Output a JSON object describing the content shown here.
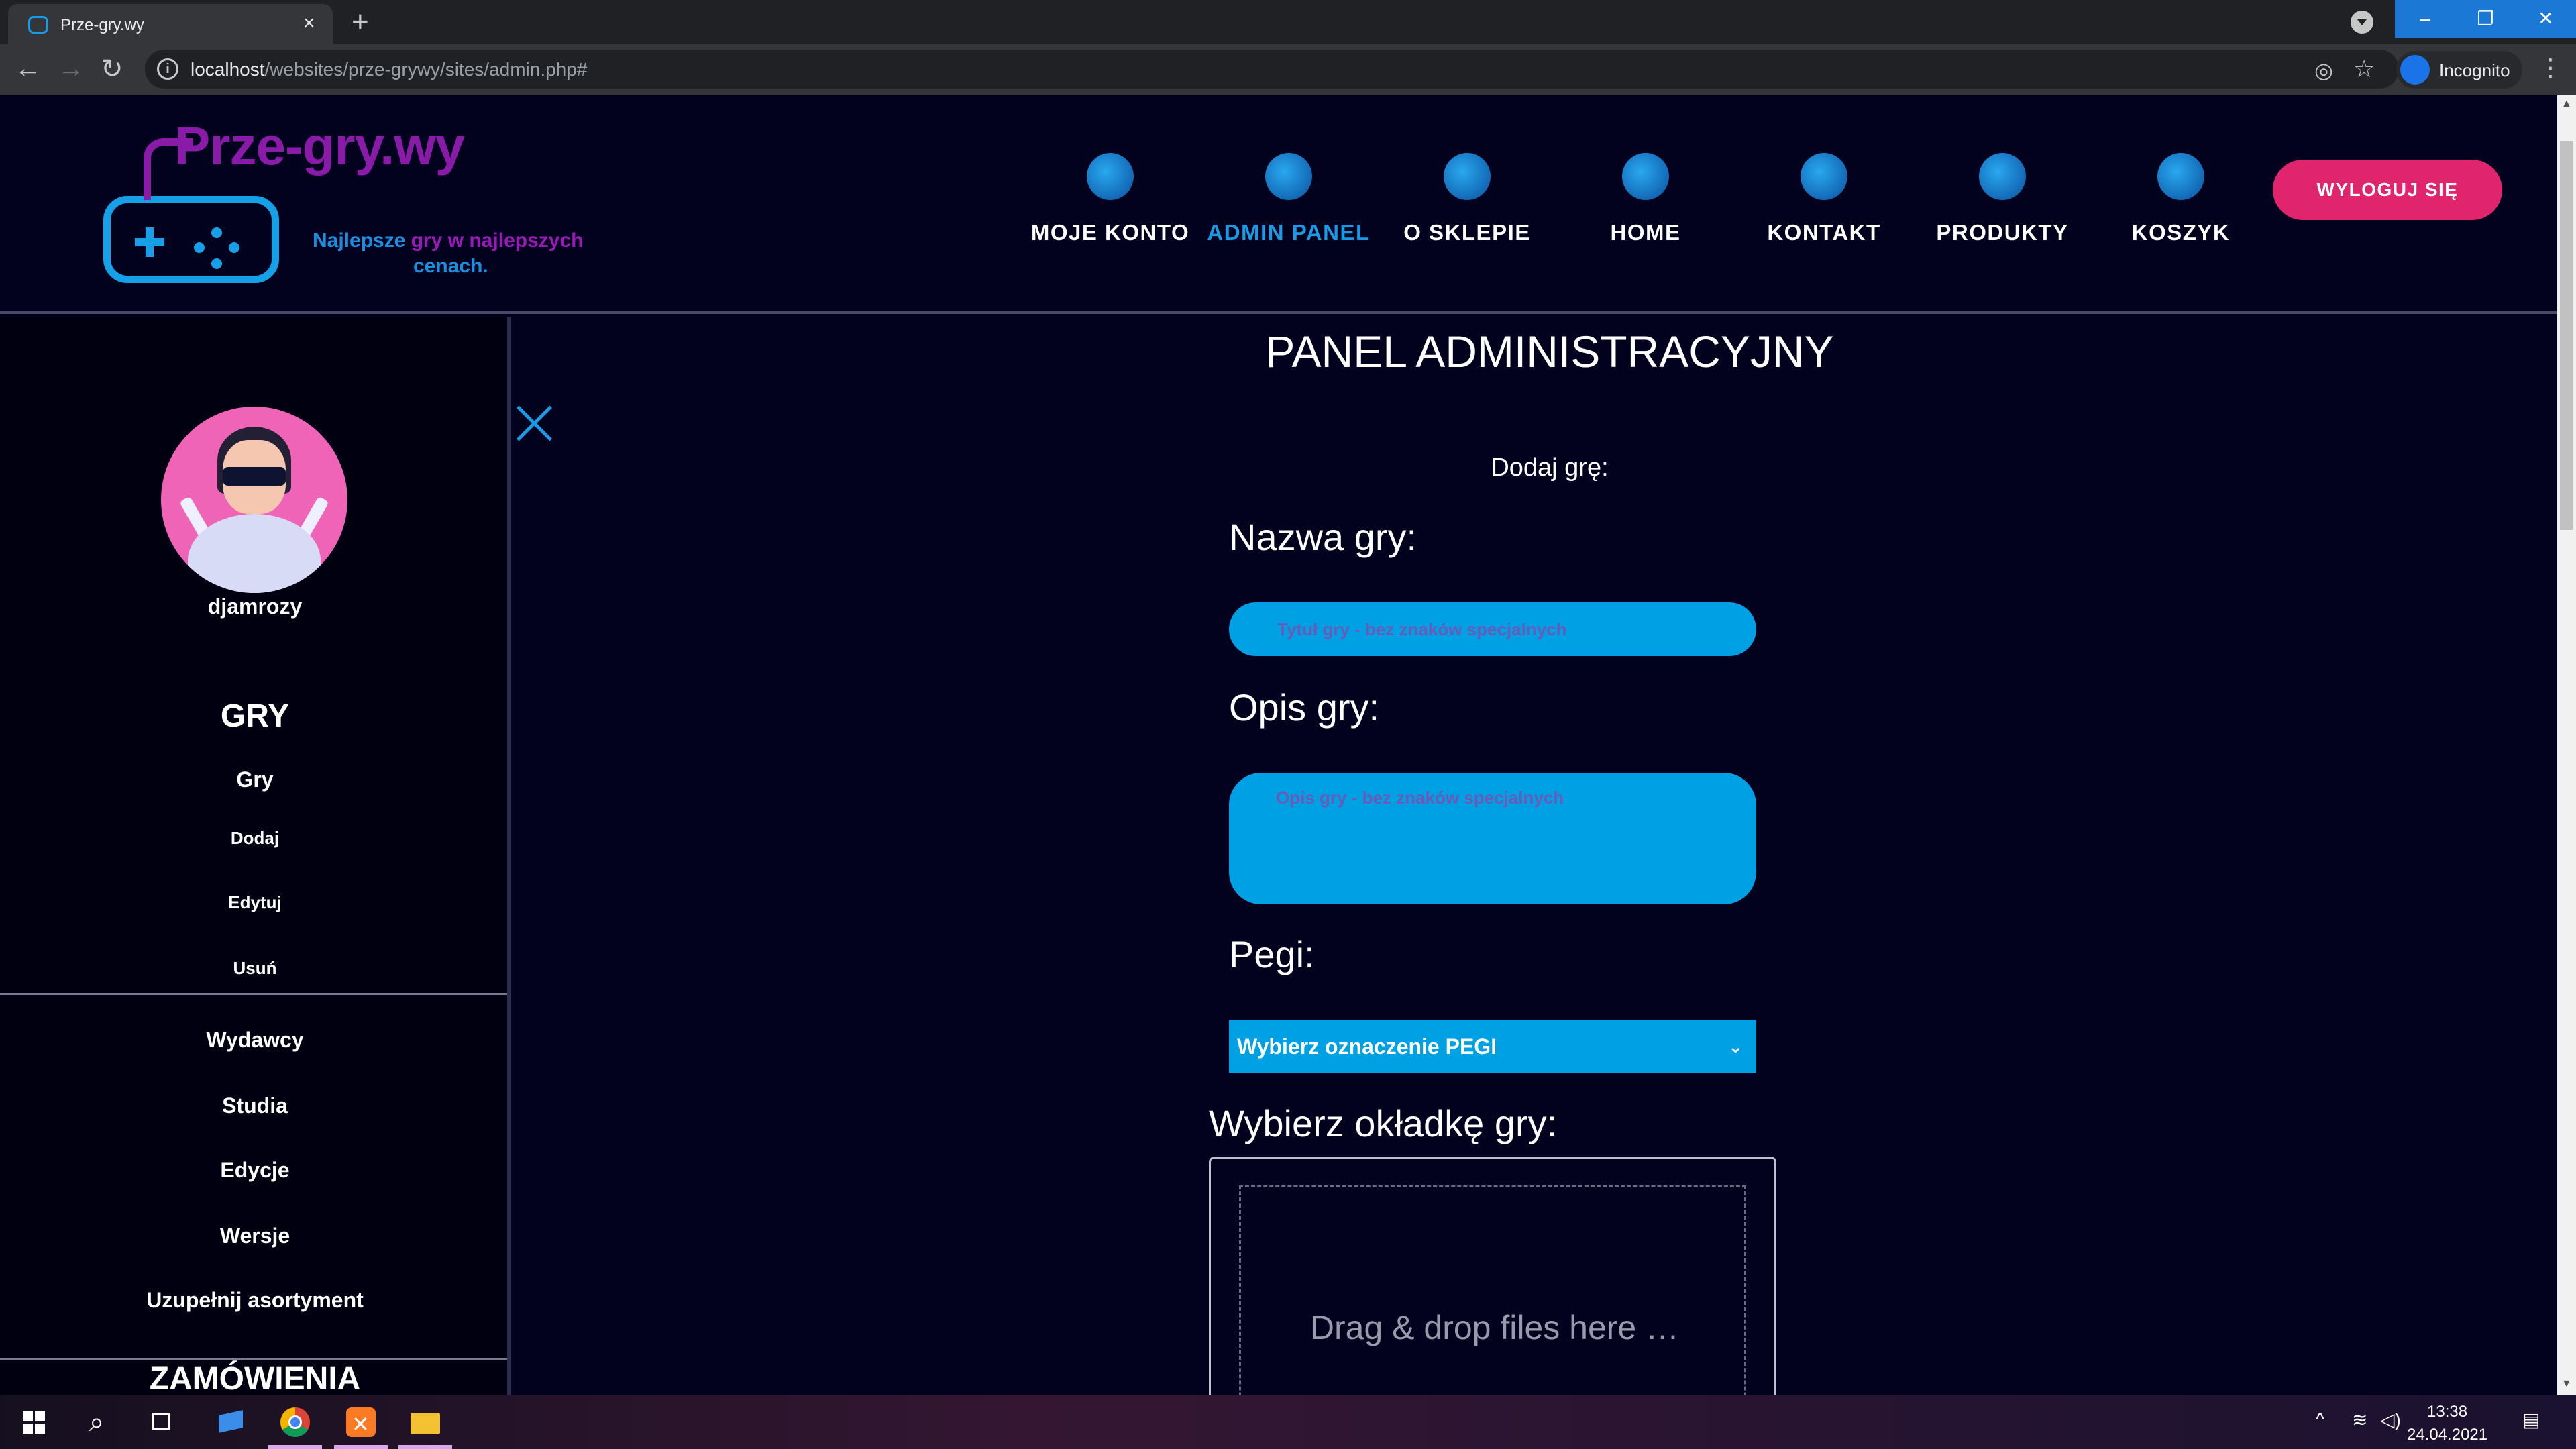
{
  "browser": {
    "tab_title": "Prze-gry.wy",
    "tab_close": "×",
    "new_tab": "+",
    "url_host": "localhost",
    "url_path": "/websites/prze-grywy/sites/admin.php#",
    "profile_label": "Incognito",
    "back": "←",
    "forward": "→",
    "reload": "↻",
    "star": "☆",
    "kebab": "⋮",
    "minimize": "–",
    "restore": "❐",
    "close": "✕"
  },
  "header": {
    "logo_title": "Prze-gry.wy",
    "logo_tagline_1": "Najlepsze ",
    "logo_tagline_2": "gry",
    "logo_tagline_3": " w najlepszych",
    "logo_tagline_4": "cenach.",
    "nav": [
      {
        "label": "MOJE KONTO",
        "icon": "account-icon"
      },
      {
        "label": "ADMIN PANEL",
        "icon": "admin-icon",
        "active": true
      },
      {
        "label": "O SKLEPIE",
        "icon": "about-icon"
      },
      {
        "label": "HOME",
        "icon": "home-icon"
      },
      {
        "label": "KONTAKT",
        "icon": "phone-icon"
      },
      {
        "label": "PRODUKTY",
        "icon": "gamepad-icon"
      },
      {
        "label": "KOSZYK",
        "icon": "cart-icon"
      }
    ],
    "logout_label": "WYLOGUJ SIĘ"
  },
  "sidebar": {
    "username": "djamrozy",
    "section_games": "GRY",
    "games_items": [
      "Gry",
      "Dodaj",
      "Edytuj",
      "Usuń"
    ],
    "other_items": [
      "Wydawcy",
      "Studia",
      "Edycje",
      "Wersje",
      "Uzupełnij asortyment"
    ],
    "section_orders": "ZAMÓWIENIA"
  },
  "main": {
    "title": "PANEL ADMINISTRACYJNY",
    "form_heading": "Dodaj grę:",
    "name_label": "Nazwa gry:",
    "name_placeholder": "Tytuł gry - bez znaków specjalnych",
    "name_value": "",
    "desc_label": "Opis gry:",
    "desc_placeholder": "Opis gry - bez znaków specjalnych",
    "desc_value": "",
    "pegi_label": "Pegi:",
    "pegi_selected": "Wybierz oznaczenie PEGI",
    "pegi_arrow": "⌄",
    "cover_label": "Wybierz okładkę gry:",
    "drop_text": "Drag & drop files here …"
  },
  "taskbar": {
    "time": "13:38",
    "date": "24.04.2021"
  },
  "colors": {
    "background": "#03021e",
    "accent_blue": "#00a0e4",
    "logout_pink": "#e0246e",
    "logo_purple": "#8a1aa8"
  }
}
